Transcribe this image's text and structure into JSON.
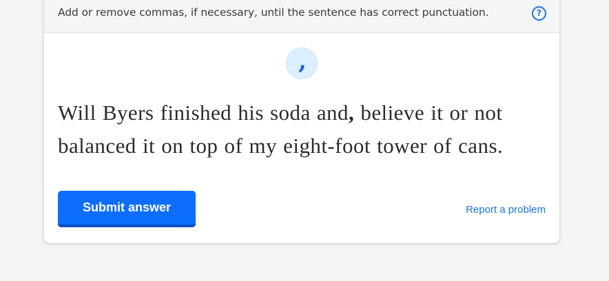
{
  "instruction": {
    "text": "Add or remove commas, if necessary, until the sentence has correct punctuation.",
    "help_icon": "question-circle-icon",
    "help_glyph": "?"
  },
  "punctuation_badge": {
    "glyph": ","
  },
  "sentence": {
    "before_comma": "Will Byers finished his soda and",
    "inserted_comma": ",",
    "after_comma": " believe it or not balanced it on top of my eight-foot tower of cans."
  },
  "actions": {
    "submit_label": "Submit answer",
    "report_label": "Report a problem"
  },
  "colors": {
    "accent": "#0d6efd",
    "link": "#1a73e8",
    "badge_bg": "#dcefff",
    "page_bg": "#f4f4f4"
  }
}
